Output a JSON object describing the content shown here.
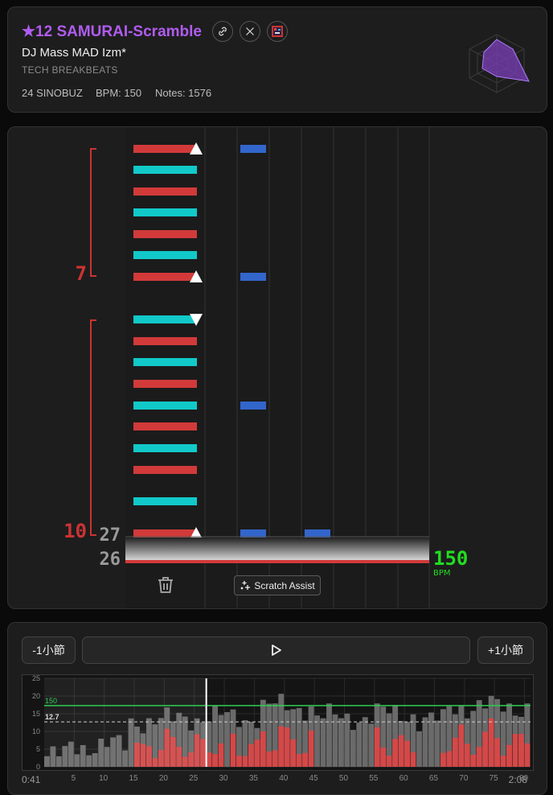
{
  "song": {
    "title": "★12 SAMURAI-Scramble",
    "artist": "DJ Mass MAD Izm*",
    "genre": "TECH BREAKBEATS",
    "version": "24 SINOBUZ",
    "bpm_text": "BPM: 150",
    "notes_text": "Notes: 1576"
  },
  "icons": {
    "link": "link-icon",
    "x": "x-logo-icon",
    "thumb": "thumbnail-icon",
    "radar": "radar-chart-icon"
  },
  "chart_view": {
    "measure_current": "27",
    "measure_previous": "26",
    "group_labels": [
      "7",
      "10"
    ],
    "bpm_value": "150",
    "bpm_unit": "BPM",
    "scratch_assist_label": "Scratch Assist",
    "colors": {
      "red": "#d23a3a",
      "cyan": "#12c9c9",
      "blue": "#3366cc",
      "bpm_green": "#22dd22"
    }
  },
  "player": {
    "prev_measure_label": "-1小節",
    "next_measure_label": "+1小節",
    "time_start": "0:41",
    "time_end": "2:08"
  },
  "density_graph": {
    "y_ticks": [
      "25",
      "20",
      "15",
      "10",
      "5",
      "0"
    ],
    "x_ticks": [
      "5",
      "10",
      "15",
      "20",
      "25",
      "30",
      "35",
      "40",
      "45",
      "50",
      "55",
      "60",
      "65",
      "70",
      "75",
      "80"
    ],
    "bpm_line_label": "150",
    "avg_line_label": "12.7",
    "avg_value": 12.7,
    "y_max": 25,
    "x_max": 81,
    "playhead": 27
  }
}
